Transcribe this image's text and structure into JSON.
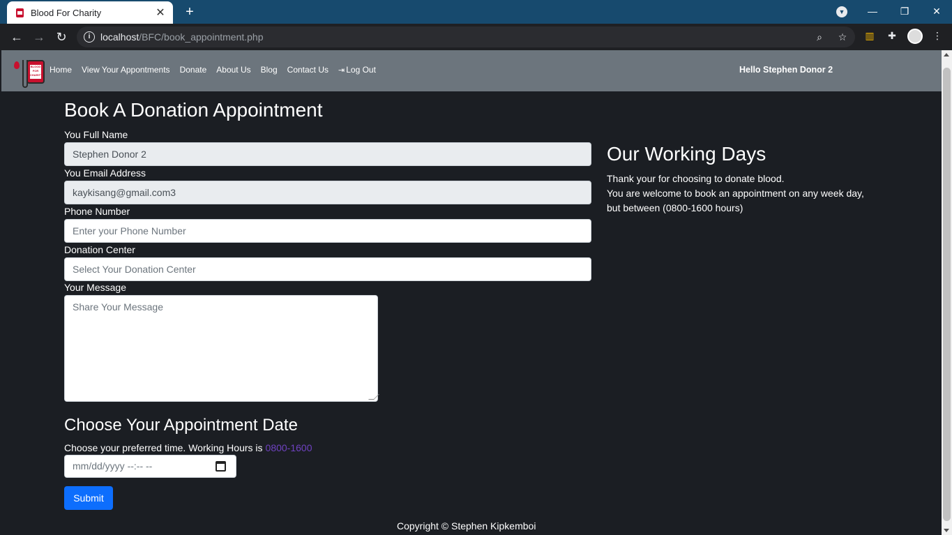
{
  "browser": {
    "tab_title": "Blood For Charity",
    "tab_close": "✕",
    "new_tab": "+",
    "url_host": "localhost",
    "url_path": "/BFC/book_appointment.php"
  },
  "nav": {
    "links": [
      "Home",
      "View Your Appontments",
      "Donate",
      "About Us",
      "Blog",
      "Contact Us"
    ],
    "logout": "Log Out",
    "greeting": "Hello Stephen Donor 2"
  },
  "form": {
    "title": "Book A Donation Appointment",
    "name_label": "You Full Name",
    "name_value": "Stephen Donor 2",
    "email_label": "You Email Address",
    "email_value": "kaykisang@gmail.com3",
    "phone_label": "Phone Number",
    "phone_placeholder": "Enter your Phone Number",
    "center_label": "Donation Center",
    "center_placeholder": "Select Your Donation Center",
    "message_label": "Your Message",
    "message_placeholder": "Share Your Message"
  },
  "side": {
    "title": "Our Working Days",
    "line1": "Thank your for choosing to donate blood.",
    "line2": "You are welcome to book an appointment on any week day, but between (0800-1600 hours)"
  },
  "appointment": {
    "title": "Choose Your Appointment Date",
    "hint": "Choose your preferred time. Working Hours is",
    "hours": "0800-1600",
    "date_placeholder": "mm/dd/yyyy --:-- --",
    "submit_label": "Submit"
  },
  "footer": "Copyright © Stephen Kipkemboi",
  "colors": {
    "tabbar": "#174a6e",
    "navbar": "#6c757d",
    "page_bg": "#1b1e23",
    "accent_button": "#0d6efd",
    "hours_text": "#6f42c1"
  }
}
